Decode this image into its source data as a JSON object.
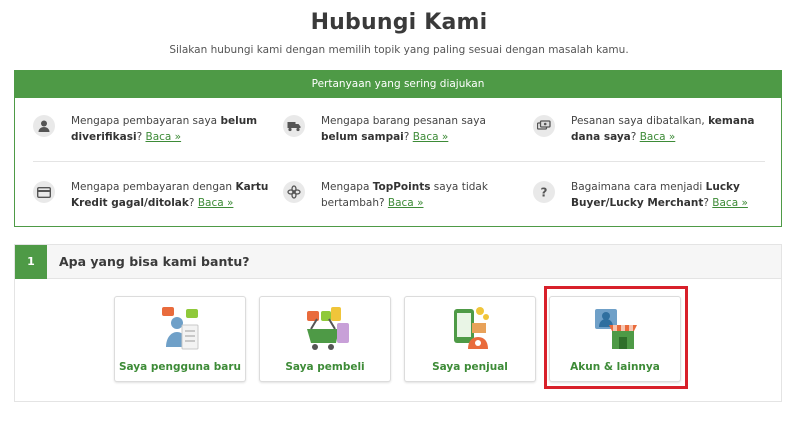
{
  "page": {
    "title": "Hubungi Kami",
    "subtitle": "Silakan hubungi kami dengan memilih topik yang paling sesuai dengan masalah kamu."
  },
  "faq": {
    "header": "Pertanyaan yang sering diajukan",
    "link_label": "Baca »",
    "items": [
      {
        "icon": "person-icon",
        "pre": "Mengapa pembayaran saya ",
        "bold": "belum diverifikasi",
        "post": "? "
      },
      {
        "icon": "truck-icon",
        "pre": "Mengapa barang pesanan saya ",
        "bold": "belum sampai",
        "post": "? "
      },
      {
        "icon": "money-icon",
        "pre": "Pesanan saya dibatalkan, ",
        "bold": "kemana dana saya",
        "post": "? "
      },
      {
        "icon": "credit-card-icon",
        "pre": "Mengapa pembayaran dengan ",
        "bold": "Kartu Kredit gagal/ditolak",
        "post": "? "
      },
      {
        "icon": "points-icon",
        "pre": "Mengapa ",
        "bold": "TopPoints",
        "post": " saya tidak bertambah? "
      },
      {
        "icon": "question-icon",
        "pre": "Bagaimana cara menjadi ",
        "bold": "Lucky Buyer/Lucky Merchant",
        "post": "? "
      }
    ]
  },
  "help": {
    "step": "1",
    "title": "Apa yang bisa kami bantu?",
    "options": [
      {
        "label": "Saya pengguna baru",
        "icon": "new-user-icon"
      },
      {
        "label": "Saya pembeli",
        "icon": "shopping-basket-icon"
      },
      {
        "label": "Saya penjual",
        "icon": "seller-icon"
      },
      {
        "label": "Akun & lainnya",
        "icon": "account-store-icon"
      }
    ]
  },
  "colors": {
    "brand_green": "#4e9a46",
    "link_green": "#3d8b37",
    "highlight_red": "#d8202a"
  }
}
